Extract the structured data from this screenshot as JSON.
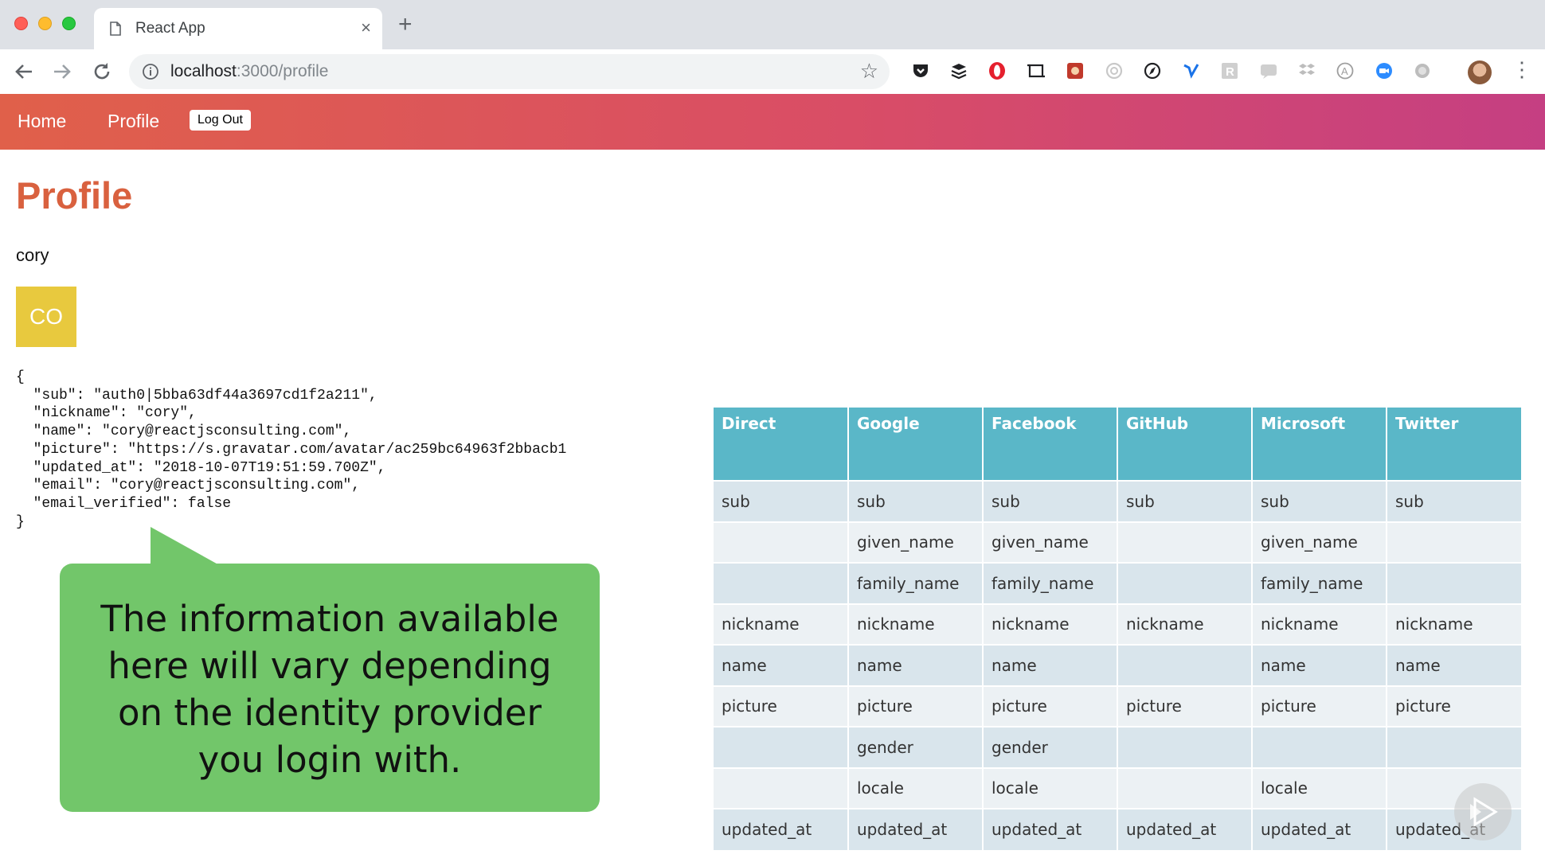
{
  "browser": {
    "tab_title": "React App",
    "tab_close": "×",
    "new_tab": "+",
    "url_host": "localhost",
    "url_path": ":3000/profile",
    "extensions": [
      "pocket-icon",
      "buffer-icon",
      "opera-icon",
      "screenshot-icon",
      "image-ext-icon",
      "refresh-circle-icon",
      "compass-icon",
      "vimeo-icon",
      "r-icon",
      "chat-icon",
      "dropbox-icon",
      "a-circle-icon",
      "zoom-icon",
      "circle-icon"
    ]
  },
  "appnav": {
    "home_label": "Home",
    "profile_label": "Profile",
    "logout_label": "Log Out"
  },
  "profile": {
    "title": "Profile",
    "username": "cory",
    "avatar_initials": "CO",
    "json": "{\n  \"sub\": \"auth0|5bba63df44a3697cd1f2a211\",\n  \"nickname\": \"cory\",\n  \"name\": \"cory@reactjsconsulting.com\",\n  \"picture\": \"https://s.gravatar.com/avatar/ac259bc64963f2bbacb1\n  \"updated_at\": \"2018-10-07T19:51:59.700Z\",\n  \"email\": \"cory@reactjsconsulting.com\",\n  \"email_verified\": false\n}"
  },
  "callout": {
    "lines": [
      "The information available",
      "here will vary depending",
      "on the identity provider",
      "you login with."
    ]
  },
  "table": {
    "headers": [
      "Direct",
      "Google",
      "Facebook",
      "GitHub",
      "Microsoft",
      "Twitter"
    ],
    "rows": [
      [
        "sub",
        "sub",
        "sub",
        "sub",
        "sub",
        "sub"
      ],
      [
        "",
        "given_name",
        "given_name",
        "",
        "given_name",
        ""
      ],
      [
        "",
        "family_name",
        "family_name",
        "",
        "family_name",
        ""
      ],
      [
        "nickname",
        "nickname",
        "nickname",
        "nickname",
        "nickname",
        "nickname"
      ],
      [
        "name",
        "name",
        "name",
        "",
        "name",
        "name"
      ],
      [
        "picture",
        "picture",
        "picture",
        "picture",
        "picture",
        "picture"
      ],
      [
        "",
        "gender",
        "gender",
        "",
        "",
        ""
      ],
      [
        "",
        "locale",
        "locale",
        "",
        "locale",
        ""
      ],
      [
        "updated_at",
        "updated_at",
        "updated_at",
        "updated_at",
        "updated_at",
        "updated_at"
      ]
    ]
  },
  "colors": {
    "title": "#d9613f",
    "table_header": "#5ab7c8",
    "callout": "#72c66a",
    "avatar": "#e8c93e"
  }
}
